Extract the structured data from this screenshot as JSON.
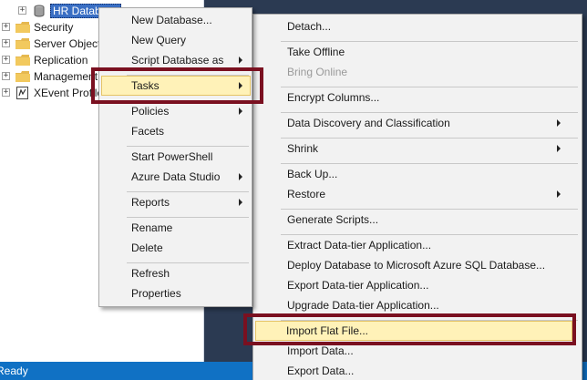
{
  "tree": {
    "items": [
      {
        "label": "HR Database",
        "selected": true
      },
      {
        "label": "Security"
      },
      {
        "label": "Server Objects"
      },
      {
        "label": "Replication"
      },
      {
        "label": "Management"
      },
      {
        "label": "XEvent Profiler"
      }
    ]
  },
  "statusbar": {
    "text": "Ready"
  },
  "context_menu": {
    "items": [
      {
        "label": "New Database..."
      },
      {
        "label": "New Query"
      },
      {
        "label": "Script Database as",
        "submenu": true
      },
      {
        "label": "Tasks",
        "submenu": true,
        "highlighted": true
      },
      {
        "label": "Policies",
        "submenu": true
      },
      {
        "label": "Facets"
      },
      {
        "label": "Start PowerShell"
      },
      {
        "label": "Azure Data Studio",
        "submenu": true
      },
      {
        "label": "Reports",
        "submenu": true
      },
      {
        "label": "Rename"
      },
      {
        "label": "Delete"
      },
      {
        "label": "Refresh"
      },
      {
        "label": "Properties"
      }
    ]
  },
  "tasks_submenu": {
    "items": [
      {
        "label": "Detach..."
      },
      {
        "label": "Take Offline"
      },
      {
        "label": "Bring Online",
        "disabled": true
      },
      {
        "label": "Encrypt Columns..."
      },
      {
        "label": "Data Discovery and Classification",
        "submenu": true
      },
      {
        "label": "Shrink",
        "submenu": true
      },
      {
        "label": "Back Up..."
      },
      {
        "label": "Restore",
        "submenu": true
      },
      {
        "label": "Generate Scripts..."
      },
      {
        "label": "Extract Data-tier Application..."
      },
      {
        "label": "Deploy Database to Microsoft Azure SQL Database..."
      },
      {
        "label": "Export Data-tier Application..."
      },
      {
        "label": "Upgrade Data-tier Application..."
      },
      {
        "label": "Import Flat File...",
        "highlighted": true
      },
      {
        "label": "Import Data..."
      },
      {
        "label": "Export Data..."
      }
    ]
  },
  "colors": {
    "background": "#2b3a52",
    "statusbar": "#1071c4",
    "highlight": "#fff2b8",
    "callout": "#7a1020",
    "selection": "#3a6fc4"
  }
}
